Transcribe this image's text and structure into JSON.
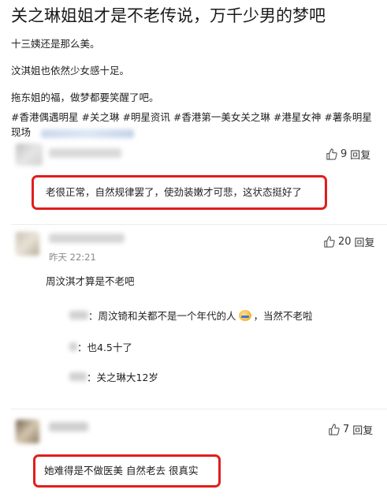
{
  "post": {
    "title": "关之琳姐姐才是不老传说，万千少男的梦吧",
    "paragraphs": [
      "十三姨还是那么美。",
      "汶淇姐也依然少女感十足。",
      "拖东姐的福，做梦都要笑醒了吧。"
    ],
    "tags": [
      "#香港偶遇明星",
      "#关之琳",
      "#明星资讯",
      "#香港第一美女关之琳",
      "#港星女神",
      "#薯条明星"
    ],
    "tags_tail": "现场"
  },
  "comments": [
    {
      "like_count": "9",
      "reply_label": "回复",
      "text": "老很正常，自然规律罢了，使劲装嫩才可悲，这状态挺好了"
    },
    {
      "like_count": "20",
      "reply_label": "回复",
      "time": "昨天 22:21",
      "text": "周汶淇才算是不老吧",
      "replies": [
        {
          "text": "：周汶锜和关都不是一个年代的人",
          "text2": "，当然不老啦"
        },
        {
          "text": "：也4.5十了"
        },
        {
          "text": "：关之琳大12岁"
        }
      ]
    },
    {
      "like_count": "7",
      "reply_label": "回复",
      "text": "她难得是不做医美 自然老去 很真实"
    }
  ],
  "colors": {
    "highlight": "#e11d1d",
    "muted": "#8a8a8a"
  }
}
